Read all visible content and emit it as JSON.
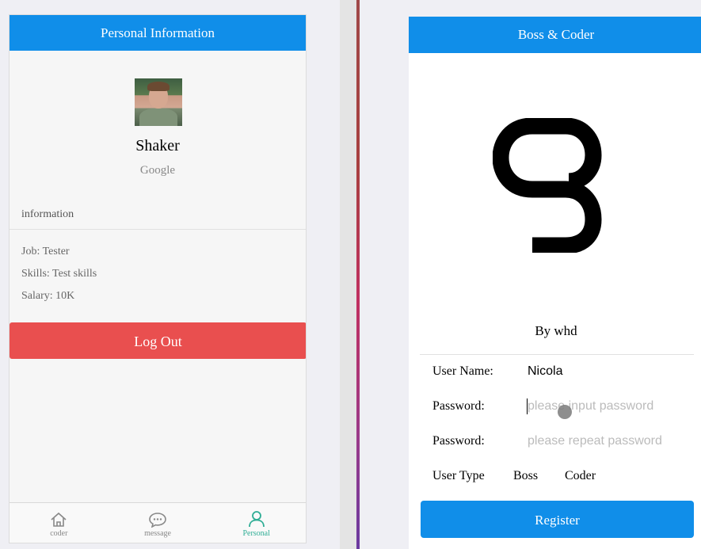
{
  "left_app": {
    "navbar_title": "Personal Information",
    "user": {
      "name": "Shaker",
      "company": "Google"
    },
    "section_title": "information",
    "info": {
      "job": "Job: Tester",
      "skills": "Skills: Test skills",
      "salary": "Salary: 10K"
    },
    "logout_label": "Log Out",
    "logout_color": "#e94f4f",
    "tabs": [
      {
        "label": "coder",
        "icon": "home-icon"
      },
      {
        "label": "message",
        "icon": "chat-bubble-icon"
      },
      {
        "label": "Personal",
        "icon": "user-icon",
        "active": true
      }
    ]
  },
  "right_app": {
    "navbar_title": "Boss & Coder",
    "logo_icon": "boss-coder-logo",
    "byline": "By whd",
    "form": {
      "username_label": "User Name:",
      "username_value": "Nicola",
      "password_label": "Password:",
      "password_placeholder": "please input password",
      "repeat_label": "Password:",
      "repeat_placeholder": "please repeat password",
      "usertype_label": "User Type",
      "usertype_options": [
        "Boss",
        "Coder"
      ]
    },
    "register_label": "Register"
  },
  "colors": {
    "brand": "#108ee9",
    "active_tab": "#2fad95",
    "danger": "#e94f4f"
  }
}
